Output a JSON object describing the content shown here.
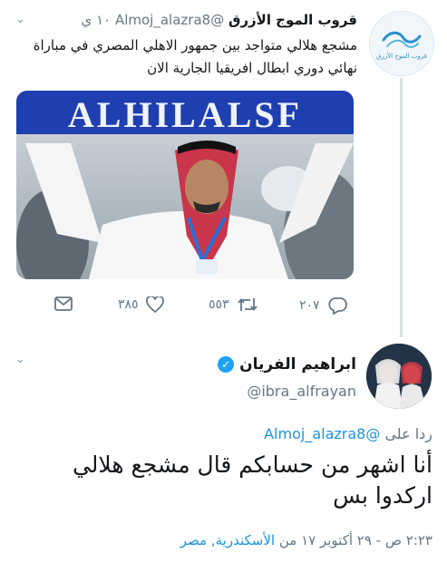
{
  "tweet1": {
    "display_name": "قروب الموج الأزرق",
    "handle": "@Almoj_alazra8",
    "time": "١٠ ي",
    "text": "مشجع هلالي متواجد بين جمهور الاهلي المصري في مباراة نهائي دوري ابطال افريقيا الجارية الان",
    "avatar_brand": "قروب الموج الأزرق",
    "media": {
      "banner_text": "ALHILALSF",
      "banner_color": "#1f3fb0"
    },
    "actions": {
      "mail_icon": "mail-icon",
      "likes": "٣٨٥",
      "retweets": "٥٥٣",
      "replies": "٢٠٧"
    }
  },
  "tweet2": {
    "display_name": "ابراهيم الفريان",
    "handle": "@ibra_alfrayan",
    "reply_prefix": "ردا على",
    "reply_to": "@Almoj_alazra8",
    "text": "أنا اشهر من حسابكم قال مشجع هلالي اركدوا بس",
    "timestamp": "٢:٢٣ ص - ٢٩ أكتوبر ١٧ من",
    "location": "الأسكندرية, مصر"
  },
  "colors": {
    "link_blue": "#1b95e0",
    "muted": "#657786",
    "verified": "#1da1f2"
  }
}
